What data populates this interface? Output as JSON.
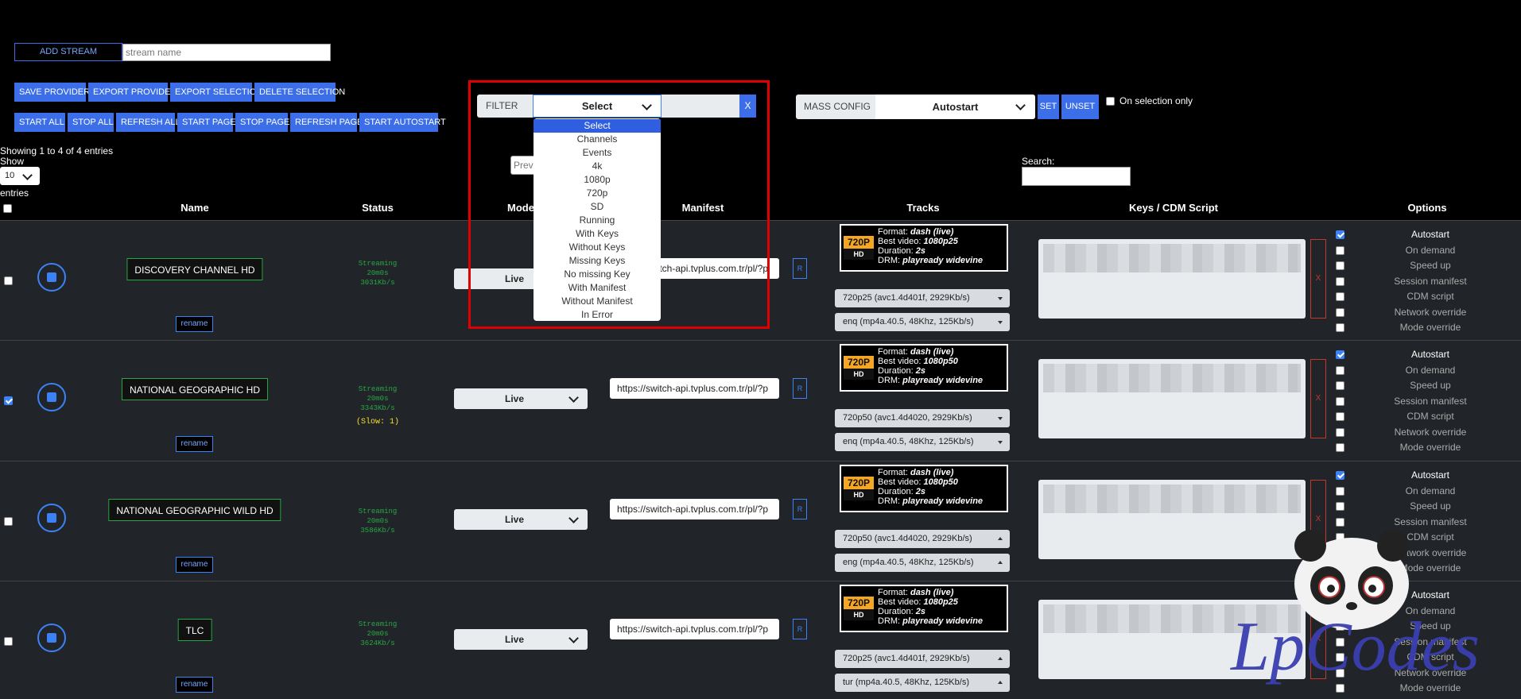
{
  "toolbar": {
    "add_stream": "ADD STREAM",
    "stream_name_placeholder": "stream name",
    "row1": [
      "SAVE PROVIDER",
      "EXPORT PROVIDER",
      "EXPORT SELECTION",
      "DELETE SELECTION"
    ],
    "row2": [
      "START ALL",
      "STOP ALL",
      "REFRESH ALL",
      "START PAGE",
      "STOP PAGE",
      "REFRESH PAGE",
      "START AUTOSTART"
    ]
  },
  "filter": {
    "label": "FILTER",
    "selected": "Select",
    "clear": "X",
    "options": [
      "Select",
      "Channels",
      "Events",
      "4k",
      "1080p",
      "720p",
      "SD",
      "Running",
      "With Keys",
      "Without Keys",
      "Missing Keys",
      "No missing Key",
      "With Manifest",
      "Without Manifest",
      "In Error"
    ]
  },
  "mass_config": {
    "label": "MASS CONFIG",
    "selected": "Autostart",
    "set": "SET",
    "unset": "UNSET",
    "on_selection_only": "On selection only"
  },
  "table_info": {
    "showing": "Showing 1 to 4 of 4 entries",
    "show": "Show",
    "page_size": "10",
    "entries": "entries",
    "prev_placeholder": "Prev",
    "search_label": "Search:"
  },
  "columns": [
    "Name",
    "Status",
    "Mode",
    "Manifest",
    "Tracks",
    "Keys / CDM Script",
    "Options"
  ],
  "rename_label": "rename",
  "r_label": "R",
  "x_label": "X",
  "option_labels": [
    "Autostart",
    "On demand",
    "Speed up",
    "Session manifest",
    "CDM script",
    "Network override",
    "Mode override"
  ],
  "track_labels": {
    "format": "Format:",
    "best": "Best video:",
    "duration": "Duration:",
    "drm": "DRM:"
  },
  "rows": [
    {
      "selected": false,
      "name": "DISCOVERY CHANNEL HD",
      "status": [
        "Streaming",
        "20m0s",
        "3031Kb/s"
      ],
      "slow": "",
      "mode": "Live",
      "manifest": "https://switch-api.tvplus.com.tr/pl/?p",
      "badge_res": "720P",
      "badge_hd": "HD",
      "format": "dash (live)",
      "best_video": "1080p25",
      "duration": "2s",
      "drm": "playready widevine",
      "video_track": "720p25 (avc1.4d401f, 2929Kb/s)",
      "video_dir": "down",
      "audio_track": "enq (mp4a.40.5, 48Khz, 125Kb/s)",
      "audio_dir": "down",
      "options_checked": [
        true,
        false,
        false,
        false,
        false,
        false,
        false
      ]
    },
    {
      "selected": true,
      "name": "NATIONAL GEOGRAPHIC HD",
      "status": [
        "Streaming",
        "20m0s",
        "3343Kb/s"
      ],
      "slow": "(Slow: 1)",
      "mode": "Live",
      "manifest": "https://switch-api.tvplus.com.tr/pl/?p",
      "badge_res": "720P",
      "badge_hd": "HD",
      "format": "dash (live)",
      "best_video": "1080p50",
      "duration": "2s",
      "drm": "playready widevine",
      "video_track": "720p50 (avc1.4d4020, 2929Kb/s)",
      "video_dir": "down",
      "audio_track": "enq (mp4a.40.5, 48Khz, 125Kb/s)",
      "audio_dir": "down",
      "options_checked": [
        true,
        false,
        false,
        false,
        false,
        false,
        false
      ]
    },
    {
      "selected": false,
      "name": "NATIONAL GEOGRAPHIC WILD HD",
      "status": [
        "Streaming",
        "20m0s",
        "3586Kb/s"
      ],
      "slow": "",
      "mode": "Live",
      "manifest": "https://switch-api.tvplus.com.tr/pl/?p",
      "badge_res": "720P",
      "badge_hd": "HD",
      "format": "dash (live)",
      "best_video": "1080p50",
      "duration": "2s",
      "drm": "playready widevine",
      "video_track": "720p50 (avc1.4d4020, 2929Kb/s)",
      "video_dir": "up",
      "audio_track": "eng (mp4a.40.5, 48Khz, 125Kb/s)",
      "audio_dir": "up",
      "options_checked": [
        true,
        false,
        false,
        false,
        false,
        false,
        false
      ]
    },
    {
      "selected": false,
      "name": "TLC",
      "status": [
        "Streaming",
        "20m0s",
        "3624Kb/s"
      ],
      "slow": "",
      "mode": "Live",
      "manifest": "https://switch-api.tvplus.com.tr/pl/?p",
      "badge_res": "720P",
      "badge_hd": "HD",
      "format": "dash (live)",
      "best_video": "1080p25",
      "duration": "2s",
      "drm": "playready widevine",
      "video_track": "720p25 (avc1.4d401f, 2929Kb/s)",
      "video_dir": "up",
      "audio_track": "tur (mp4a.40.5, 48Khz, 125Kb/s)",
      "audio_dir": "up",
      "options_checked": [
        false,
        false,
        false,
        false,
        false,
        false,
        false
      ]
    }
  ],
  "watermark": "LpCodes",
  "colors": {
    "accent": "#3b6ee8",
    "highlight_box": "#e00000",
    "status_green": "#28a745",
    "slow_yellow": "#f5e02a"
  }
}
